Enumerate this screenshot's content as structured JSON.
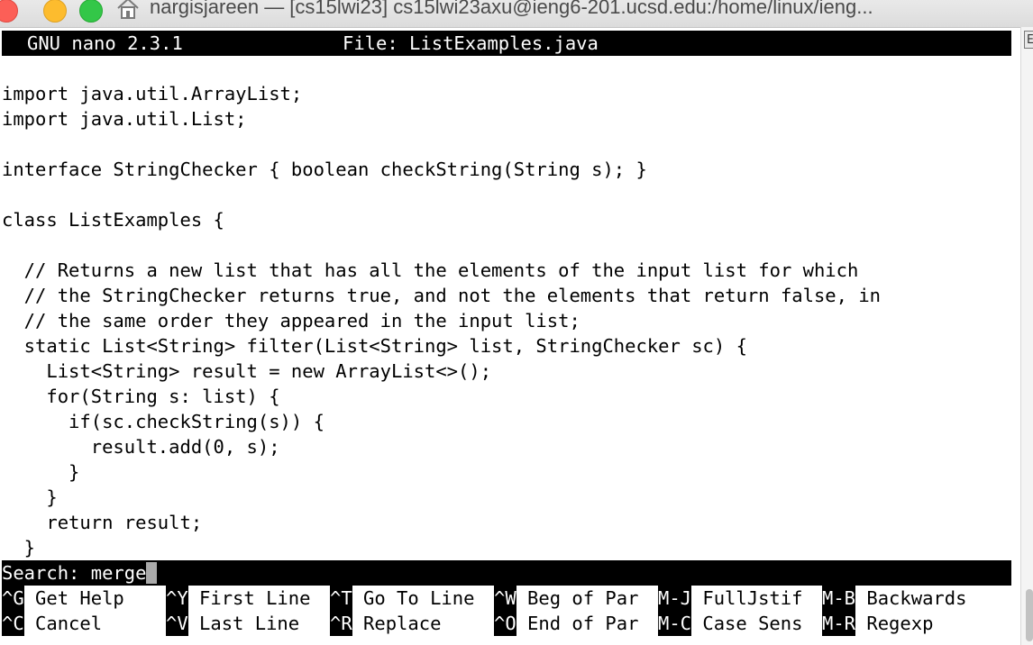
{
  "window": {
    "title": "nargisjareen — [cs15lwi23]  cs15lwi23axu@ieng6-201.ucsd.edu:/home/linux/ieng..."
  },
  "nano": {
    "version": "GNU nano 2.3.1",
    "file_label": "File: ListExamples.java",
    "lines": [
      "",
      "import java.util.ArrayList;",
      "import java.util.List;",
      "",
      "interface StringChecker { boolean checkString(String s); }",
      "",
      "class ListExamples {",
      "",
      "  // Returns a new list that has all the elements of the input list for which",
      "  // the StringChecker returns true, and not the elements that return false, in",
      "  // the same order they appeared in the input list;",
      "  static List<String> filter(List<String> list, StringChecker sc) {",
      "    List<String> result = new ArrayList<>();",
      "    for(String s: list) {",
      "      if(sc.checkString(s)) {",
      "        result.add(0, s);",
      "      }",
      "    }",
      "    return result;",
      "  }"
    ],
    "search_prompt": "Search: ",
    "search_value": "merge",
    "shortcuts_row1": [
      {
        "key": "^G",
        "label": " Get Help"
      },
      {
        "key": "^Y",
        "label": " First Line"
      },
      {
        "key": "^T",
        "label": " Go To Line"
      },
      {
        "key": "^W",
        "label": " Beg of Par"
      },
      {
        "key": "M-J",
        "label": " FullJstif"
      },
      {
        "key": "M-B",
        "label": " Backwards"
      }
    ],
    "shortcuts_row2": [
      {
        "key": "^C",
        "label": " Cancel"
      },
      {
        "key": "^V",
        "label": " Last Line"
      },
      {
        "key": "^R",
        "label": " Replace"
      },
      {
        "key": "^O",
        "label": " End of Par"
      },
      {
        "key": "M-C",
        "label": " Case Sens"
      },
      {
        "key": "M-R",
        "label": " Regexp"
      }
    ]
  },
  "scrollbar": {
    "tab_glyph": "E"
  },
  "colors": {
    "inverse_bg": "#000000",
    "inverse_fg": "#ffffff",
    "close": "#fc5f57",
    "minimize": "#fdbc2e",
    "zoom": "#33c748"
  },
  "icons": [
    "close-button",
    "minimize-button",
    "zoom-button",
    "home-icon"
  ]
}
